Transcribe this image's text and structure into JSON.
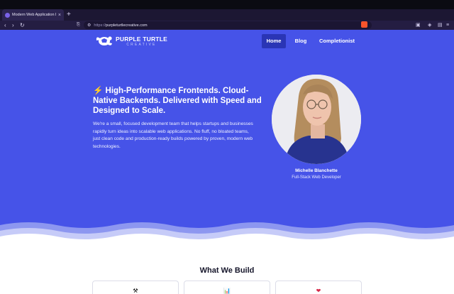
{
  "browser": {
    "tab_title": "Modern Web Application Dev",
    "tab_close": "×",
    "new_tab": "+",
    "back": "‹",
    "forward": "›",
    "reload": "↻",
    "bookmark": "⎘",
    "url_proto": "https://",
    "url_domain": "purpleturtlecreative.com"
  },
  "header": {
    "logo_main": "PURPLE TURTLE",
    "logo_sub": "CREATIVE",
    "nav": [
      {
        "label": "Home",
        "active": true
      },
      {
        "label": "Blog",
        "active": false
      },
      {
        "label": "Completionist",
        "active": false
      }
    ]
  },
  "hero": {
    "title": "⚡ High-Performance Frontends. Cloud-Native Backends. Delivered with Speed and Designed to Scale.",
    "body": "We're a small, focused development team that helps startups and businesses rapidly turn ideas into scalable web applications. No fluff, no bloated teams, just clean code and production-ready builds powered by proven, modern web technologies.",
    "person_name": "Michelle Blanchette",
    "person_role": "Full-Stack Web Developer"
  },
  "section": {
    "title": "What We Build",
    "cards": [
      {
        "icon": "⚒",
        "icon_name": "tools-icon"
      },
      {
        "icon": "📊",
        "icon_name": "bar-chart-icon"
      },
      {
        "icon": "❤",
        "icon_name": "heart-icon"
      }
    ]
  },
  "colors": {
    "hero_bg": "#4653e8",
    "nav_active": "#2a35b5",
    "browser_bg": "#1c1733"
  }
}
